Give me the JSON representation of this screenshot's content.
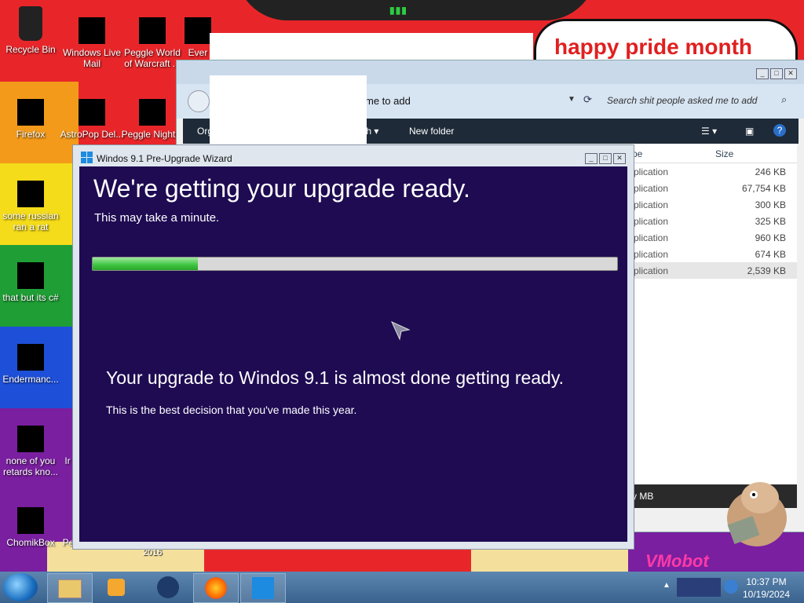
{
  "desktop": {
    "banner_text": "happy pride month",
    "corner_text": "VMobot",
    "icons": [
      {
        "label": "Recycle Bin"
      },
      {
        "label": "Windows Live Mail"
      },
      {
        "label": "Peggle World of Warcraft ..."
      },
      {
        "label": "Ever"
      },
      {
        "label": "Firefox"
      },
      {
        "label": "AstroPop Del..."
      },
      {
        "label": "Peggle Night..."
      },
      {
        "label": "some russian ran a rat"
      },
      {
        "label": "that but its c#"
      },
      {
        "label": "Endermanc..."
      },
      {
        "label": "none of you retards kno..."
      },
      {
        "label": "ChomikBox"
      },
      {
        "label": "Pe"
      },
      {
        "label": "Ir"
      },
      {
        "label": "2016"
      }
    ]
  },
  "explorer": {
    "path_fragment": "me to add",
    "search_placeholder": "Search shit people asked me to add",
    "cmd": {
      "organize": "Org",
      "burn": "th",
      "new_folder": "New folder"
    },
    "columns": {
      "type": "pe",
      "size": "Size"
    },
    "rows": [
      {
        "type": "plication",
        "size": "246 KB"
      },
      {
        "type": "plication",
        "size": "67,754 KB"
      },
      {
        "type": "plication",
        "size": "300 KB"
      },
      {
        "type": "plication",
        "size": "325 KB"
      },
      {
        "type": "plication",
        "size": "960 KB"
      },
      {
        "type": "plication",
        "size": "674 KB"
      },
      {
        "type": "plication",
        "size": "2,539 KB"
      }
    ],
    "footer": "y MB"
  },
  "wizard": {
    "title": "Windos 9.1 Pre-Upgrade Wizard",
    "heading": "We're getting your upgrade ready.",
    "subheading": "This may take a minute.",
    "progress_fraction": 0.2,
    "message": "Your upgrade to Windos 9.1 is almost done getting ready.",
    "detail": "This is the best decision that you've made this year."
  },
  "taskbar": {
    "time": "10:37 PM",
    "date": "10/19/2024"
  }
}
